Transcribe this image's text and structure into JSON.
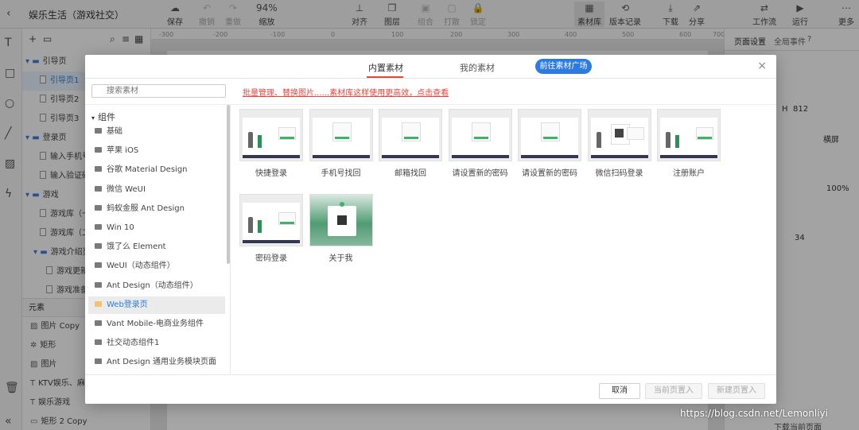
{
  "app": {
    "title": "娱乐生活（游戏社交）"
  },
  "toolbar": {
    "save": "保存",
    "undo": "撤销",
    "redo": "重做",
    "zoom_value": "94%",
    "zoom": "缩放",
    "align": "对齐",
    "layer": "图层",
    "combine": "组合",
    "break": "打散",
    "lock": "锁定",
    "library": "素材库",
    "history": "版本记录",
    "download": "下载",
    "share": "分享",
    "flow": "工作流",
    "run": "运行",
    "more": "更多"
  },
  "ruler": [
    "-300",
    "-200",
    "-100",
    "0",
    "100",
    "200",
    "300",
    "400",
    "500",
    "600",
    "700"
  ],
  "pages": [
    {
      "label": "引导页",
      "type": "folder"
    },
    {
      "label": "引导页1",
      "type": "page",
      "selected": true
    },
    {
      "label": "引导页2",
      "type": "page"
    },
    {
      "label": "引导页3",
      "type": "page"
    },
    {
      "label": "登录页",
      "type": "folder"
    },
    {
      "label": "输入手机号",
      "type": "page"
    },
    {
      "label": "输入验证码",
      "type": "page"
    },
    {
      "label": "游戏",
      "type": "folder"
    },
    {
      "label": "游戏库（一",
      "type": "page"
    },
    {
      "label": "游戏库（二",
      "type": "page"
    },
    {
      "label": "游戏介绍页",
      "type": "folder2"
    },
    {
      "label": "游戏更新",
      "type": "page"
    },
    {
      "label": "游戏准备",
      "type": "page"
    }
  ],
  "elements": {
    "header": "元素",
    "items": [
      "图片 Copy",
      "矩形",
      "图片",
      "KTV娱乐、麻",
      "娱乐游戏",
      "矩形 2 Copy"
    ]
  },
  "right_panel": {
    "tab_page": "页面设置",
    "tab_events": "全局事件",
    "height_label": "H",
    "height_value": "812",
    "orient": "横屏",
    "percent": "100%",
    "value34": "34",
    "bottom_label": "下载当前页面"
  },
  "modal": {
    "tab_builtin": "内置素材",
    "tab_mine": "我的素材",
    "plaza_button": "前往素材广场",
    "search_placeholder": "搜索素材",
    "tip": "批量管理、替换图片......素材库这样使用更高效，点击查看",
    "section_header": "组件",
    "categories": [
      {
        "label": "基础"
      },
      {
        "label": "苹果 iOS"
      },
      {
        "label": "谷歌 Material Design"
      },
      {
        "label": "微信 WeUI"
      },
      {
        "label": "蚂蚁金服 Ant Design"
      },
      {
        "label": "Win 10"
      },
      {
        "label": "饿了么 Element"
      },
      {
        "label": "WeUI（动态组件）"
      },
      {
        "label": "Ant Design（动态组件）"
      },
      {
        "label": "Web登录页",
        "selected": true
      },
      {
        "label": "Vant Mobile-电商业务组件"
      },
      {
        "label": "社交动态组件1"
      },
      {
        "label": "Ant Design 通用业务模块页面"
      }
    ],
    "tiles": [
      {
        "label": "快捷登录",
        "kind": "figures"
      },
      {
        "label": "手机号找回",
        "kind": "form"
      },
      {
        "label": "邮箱找回",
        "kind": "form"
      },
      {
        "label": "请设置新的密码",
        "kind": "form"
      },
      {
        "label": "请设置新的密码",
        "kind": "form"
      },
      {
        "label": "微信扫码登录",
        "kind": "qr"
      },
      {
        "label": "注册账户",
        "kind": "figures"
      },
      {
        "label": "密码登录",
        "kind": "figures"
      },
      {
        "label": "关于我",
        "kind": "green"
      }
    ],
    "buttons": {
      "cancel": "取消",
      "current_page": "当前页置入",
      "new_page": "新建页置入"
    }
  },
  "watermark": "https://blog.csdn.net/Lemonliyi"
}
